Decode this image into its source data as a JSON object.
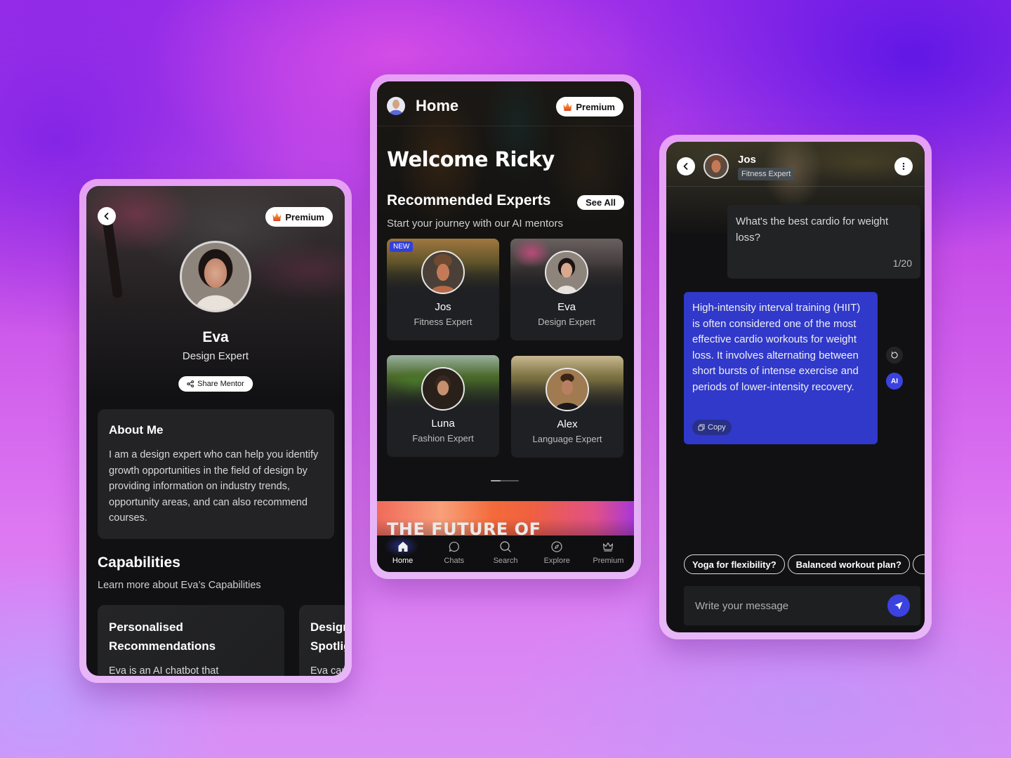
{
  "profile_screen": {
    "premium_label": "Premium",
    "name": "Eva",
    "role": "Design Expert",
    "share_label": "Share Mentor",
    "about": {
      "title": "About Me",
      "text": "I am a design expert who can help you identify growth opportunities in the field of design by providing information on industry trends, opportunity areas, and can also recommend courses."
    },
    "capabilities": {
      "title": "Capabilities",
      "subtitle": "Learn more about Eva’s Capabilities",
      "cards": [
        {
          "title": "Personalised Recommendations",
          "text": "Eva is an AI chatbot that"
        },
        {
          "title": "Design Spotlight",
          "text": "Eva can"
        }
      ]
    }
  },
  "home_screen": {
    "title": "Home",
    "premium_label": "Premium",
    "welcome": "Welcome Ricky",
    "recommended": {
      "title": "Recommended Experts",
      "see_all": "See All",
      "subtitle": "Start your journey with our AI mentors"
    },
    "experts": [
      {
        "name": "Jos",
        "role": "Fitness Expert",
        "badge": "NEW"
      },
      {
        "name": "Eva",
        "role": "Design Expert"
      },
      {
        "name": "Luna",
        "role": "Fashion Expert"
      },
      {
        "name": "Alex",
        "role": "Language Expert"
      }
    ],
    "banner_text": "THE FUTURE OF",
    "nav": [
      {
        "label": "Home",
        "icon": "home-icon",
        "active": true
      },
      {
        "label": "Chats",
        "icon": "chat-bubble-icon"
      },
      {
        "label": "Search",
        "icon": "search-icon"
      },
      {
        "label": "Explore",
        "icon": "compass-icon"
      },
      {
        "label": "Premium",
        "icon": "crown-icon"
      }
    ]
  },
  "chat_screen": {
    "name": "Jos",
    "role": "Fitness Expert",
    "user_message": {
      "text": "What's the best cardio for weight loss?",
      "counter": "1/20"
    },
    "ai_message": {
      "text": "High-intensity interval training (HIIT) is often considered one of the most effective cardio workouts for weight loss. It involves alternating between short bursts of intense exercise and periods of lower-intensity recovery.",
      "copy_label": "Copy"
    },
    "ai_badge": "AI",
    "suggestions": [
      "Yoga for flexibility?",
      "Balanced workout plan?",
      ""
    ],
    "input_placeholder": "Write your message"
  },
  "colors": {
    "accent_blue": "#3039ca",
    "screen_bg": "#111113",
    "card_bg": "#232325"
  }
}
